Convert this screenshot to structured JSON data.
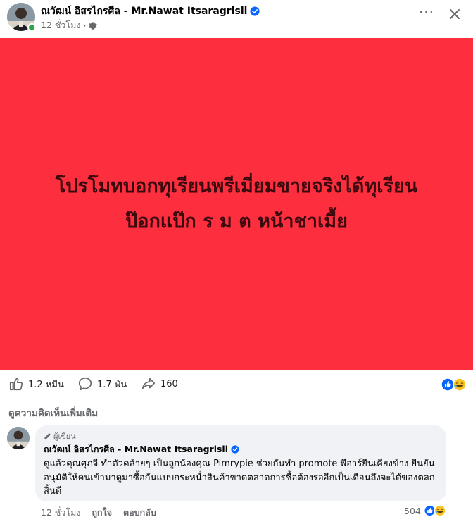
{
  "post": {
    "author": "ณวัฒน์ อิสรไกรศีล - Mr.Nawat Itsaragrisil",
    "time": "12 ชั่วโมง",
    "dot": "·",
    "more_label": "···",
    "banner_lines": [
      "โปรโมทบอกทุเรียนพรีเมี่ยมขายจริงได้ทุเรียน",
      "ป๊อกแป๊ก ร ม ต หน้าชาเมื้ย"
    ],
    "banner_color": "#fd2f3f"
  },
  "stats": {
    "likes": "1.2 หมื่น",
    "comments": "1.7 พัน",
    "shares": "160"
  },
  "comments_section": {
    "more_comments_label": "ดูความคิดเห็นเพิ่มเติม",
    "comment": {
      "badge": "ผู้เขียน",
      "author": "ณวัฒน์ อิสรไกรศีล - Mr.Nawat Itsaragrisil",
      "text": "ดูแล้วคุณศุภจี ทำตัวคล้ายๆ เป็นลูกน้องคุณ Pimrypie ช่วยกันทำ promote พีอาร์ยืนเคียงข้าง ยืนยันอนุมัติให้คนเข้ามาดูมาซื้อกันแบบกระหน่ำสินค้าขาดตลาดการซื้อต้องรออีกเป็นเดือนถึงจะได้ของตลกสิ้นดี",
      "time": "12 ชั่วโมง",
      "like_label": "ถูกใจ",
      "reply_label": "ตอบกลับ",
      "reaction_count": "504"
    }
  },
  "colors": {
    "facebook_blue": "#0866ff",
    "text_secondary": "#65676b",
    "online_green": "#31a24c"
  }
}
